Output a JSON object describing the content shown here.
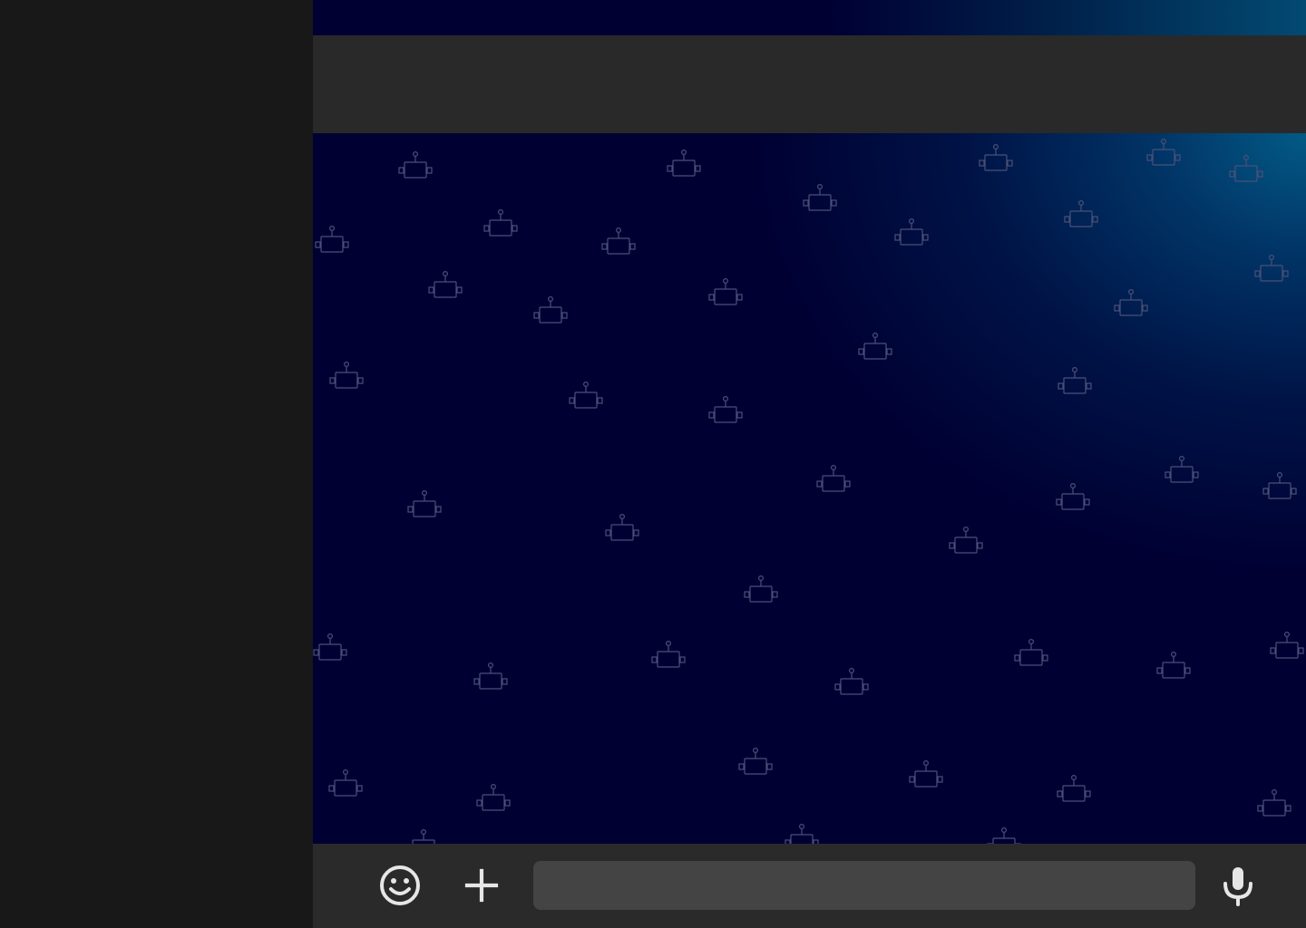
{
  "app": {
    "colors": {
      "sidebar": "#181818",
      "header": "#292929",
      "chat_background": "#000033",
      "chat_glow": "#035a86",
      "composer": "#2a2a2a",
      "input_background": "#444444",
      "icon": "#e6e6e6",
      "pattern_stroke": "#4a5078"
    }
  },
  "chat": {
    "wallpaper_icon": "robot-icon"
  },
  "composer": {
    "emoji_icon": "smiley-icon",
    "attach_icon": "plus-icon",
    "mic_icon": "microphone-icon",
    "message_value": "",
    "message_placeholder": ""
  }
}
